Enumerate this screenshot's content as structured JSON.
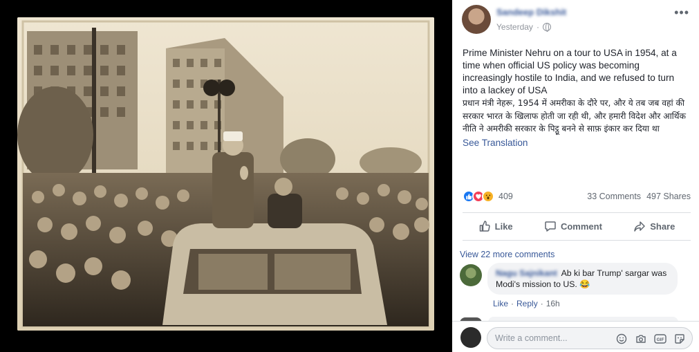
{
  "post": {
    "author": "Sandeep Dikshit",
    "time": "Yesterday",
    "more_label": "•••",
    "text_en": "Prime Minister Nehru on a tour to USA in 1954, at a time when official US policy was becoming increasingly hostile to India, and we refused to turn into a lackey of USA",
    "text_hi": "प्रधान मंत्री नेहरू, 1954 में अमरीका के दौरे पर, और ये तब जब वहां की सरकार भारत के खिलाफ होती जा रही थी, और हमारी विदेश और आर्थिक नीति ने अमरीकी सरकार के पिट्ठू बनने से साफ़ इंकार कर दिया था",
    "see_translation": "See Translation"
  },
  "stats": {
    "reactions_count": "409",
    "comments": "33 Comments",
    "shares": "497 Shares",
    "reaction_icons": [
      "like-icon",
      "love-icon",
      "wow-icon"
    ]
  },
  "actions": {
    "like": "Like",
    "comment": "Comment",
    "share": "Share"
  },
  "comments": {
    "view_more": "View 22 more comments",
    "items": [
      {
        "name": "Nagu Sajnikant",
        "text": "Ab ki bar Trump' sargar was Modi's mission to US.",
        "emoji": "😂",
        "like": "Like",
        "reply": "Reply",
        "time": "16h"
      }
    ]
  },
  "composer": {
    "placeholder": "Write a comment...",
    "gif_label": "GIF"
  },
  "colors": {
    "link": "#385898",
    "text": "#1d2129",
    "meta": "#90949c",
    "like_blue": "#1877f2",
    "love_red": "#f33e58",
    "wow_yellow": "#f7b125"
  }
}
